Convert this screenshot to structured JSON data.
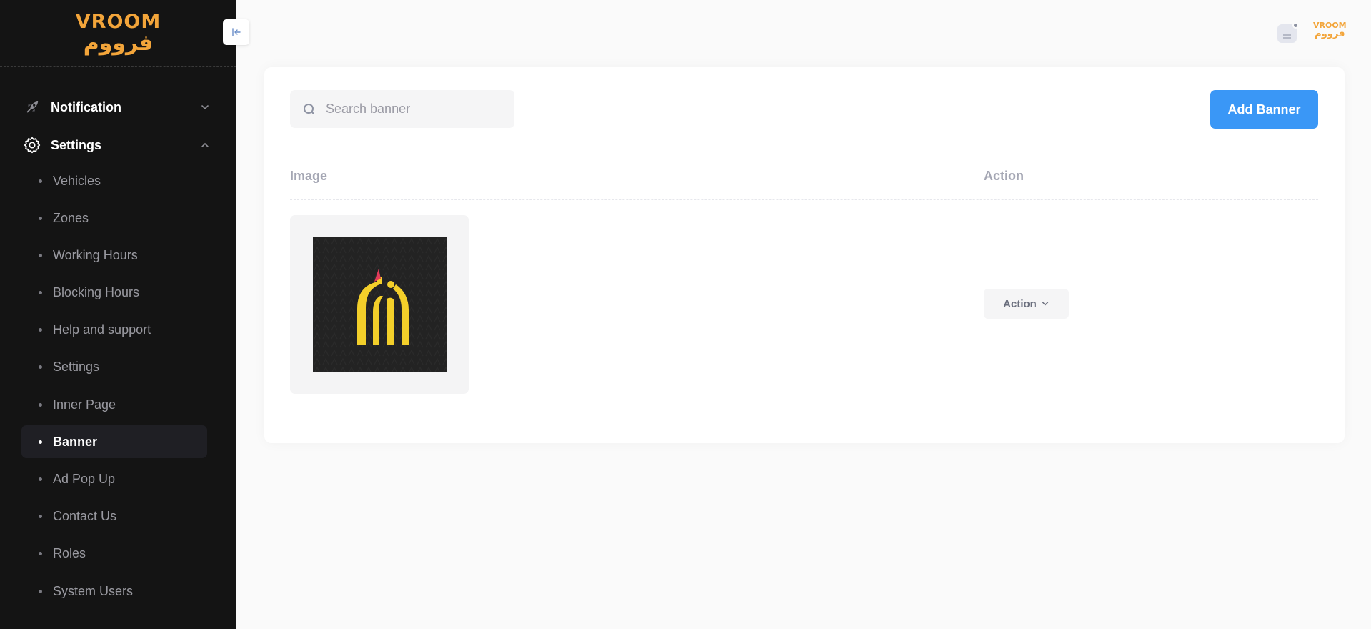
{
  "brand": {
    "name_en": "VROOM",
    "name_ar": "فرووم",
    "accent": "#f3a53a"
  },
  "sidebar": {
    "sections": [
      {
        "label": "Notification",
        "icon": "rocket-icon",
        "expanded": false
      },
      {
        "label": "Settings",
        "icon": "gear-icon",
        "expanded": true
      }
    ],
    "sub_items": [
      {
        "label": "Vehicles",
        "active": false
      },
      {
        "label": "Zones",
        "active": false
      },
      {
        "label": "Working Hours",
        "active": false
      },
      {
        "label": "Blocking Hours",
        "active": false
      },
      {
        "label": "Help and support",
        "active": false
      },
      {
        "label": "Settings",
        "active": false
      },
      {
        "label": "Inner Page",
        "active": false
      },
      {
        "label": "Banner",
        "active": true
      },
      {
        "label": "Ad Pop Up",
        "active": false
      },
      {
        "label": "Contact Us",
        "active": false
      },
      {
        "label": "Roles",
        "active": false
      },
      {
        "label": "System Users",
        "active": false
      }
    ]
  },
  "toolbar": {
    "search_placeholder": "Search banner",
    "search_value": "",
    "add_label": "Add Banner",
    "add_color": "#3a97f6"
  },
  "table": {
    "columns": [
      "Image",
      "Action"
    ],
    "rows": [
      {
        "image": "banner-logo-image",
        "action_label": "Action"
      }
    ]
  }
}
